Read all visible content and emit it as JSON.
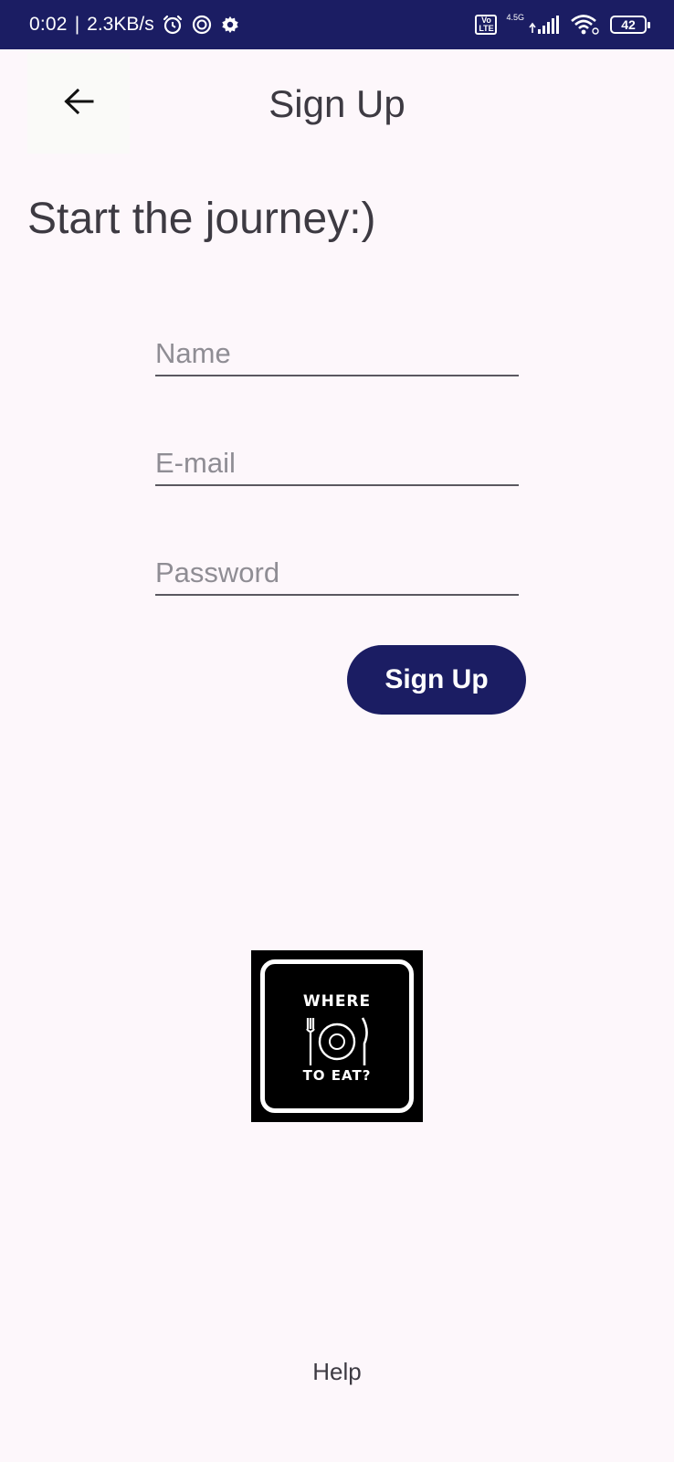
{
  "status_bar": {
    "time": "0:02",
    "separator": "|",
    "net_speed": "2.3KB/s",
    "network_gen": "4.5G",
    "volte_top": "Vo",
    "volte_bottom": "LTE",
    "battery_level": "42"
  },
  "app_bar": {
    "title": "Sign Up"
  },
  "heading": "Start the journey:)",
  "form": {
    "name_placeholder": "Name",
    "email_placeholder": "E-mail",
    "password_placeholder": "Password",
    "submit_label": "Sign Up"
  },
  "logo": {
    "line1": "WHERE",
    "line2": "TO EAT?"
  },
  "footer": {
    "help_label": "Help"
  },
  "colors": {
    "primary": "#1b1d63",
    "background": "#fdf7fb",
    "text": "#3d3a42"
  },
  "icons": {
    "back": "arrow-back-icon",
    "alarm": "alarm-icon",
    "sync": "sync-icon",
    "settings": "gear-icon",
    "signal": "signal-icon",
    "wifi": "wifi-icon",
    "battery": "battery-icon"
  }
}
